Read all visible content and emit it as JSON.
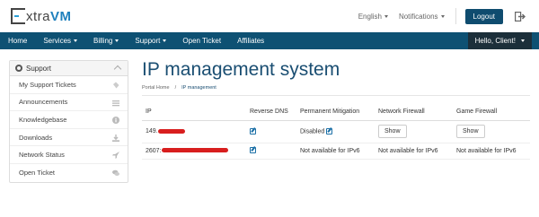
{
  "brand": {
    "name_part1": "xtra",
    "name_part2": "VM",
    "logo_letter": "E"
  },
  "header": {
    "language": "English",
    "notifications": "Notifications",
    "logout": "Logout"
  },
  "nav": {
    "items": [
      {
        "label": "Home",
        "dropdown": false
      },
      {
        "label": "Services",
        "dropdown": true
      },
      {
        "label": "Billing",
        "dropdown": true
      },
      {
        "label": "Support",
        "dropdown": true
      },
      {
        "label": "Open Ticket",
        "dropdown": false
      },
      {
        "label": "Affiliates",
        "dropdown": false
      }
    ],
    "user": "Hello, Client!"
  },
  "sidebar": {
    "title": "Support",
    "items": [
      {
        "label": "My Support Tickets",
        "icon": "ticket-icon"
      },
      {
        "label": "Announcements",
        "icon": "list-icon"
      },
      {
        "label": "Knowledgebase",
        "icon": "info-icon"
      },
      {
        "label": "Downloads",
        "icon": "download-icon"
      },
      {
        "label": "Network Status",
        "icon": "rocket-icon"
      },
      {
        "label": "Open Ticket",
        "icon": "comments-icon"
      }
    ]
  },
  "page": {
    "title": "IP management system",
    "breadcrumb": [
      "Portal Home",
      "/",
      "IP management"
    ]
  },
  "table": {
    "headers": [
      "IP",
      "Reverse DNS",
      "Permanent Mitigation",
      "Network Firewall",
      "Game Firewall"
    ],
    "rows": [
      {
        "ip": "149.",
        "mitigation": "Disabled",
        "network_fw": "Show",
        "game_fw": "Show"
      },
      {
        "ip": "2607:",
        "mitigation": "Not available for IPv6",
        "network_fw": "Not available for IPv6",
        "game_fw": "Not available for IPv6"
      }
    ]
  },
  "colors": {
    "nav_bg": "#0e5173",
    "accent": "#1a4e72",
    "redaction": "#d81e1e"
  }
}
